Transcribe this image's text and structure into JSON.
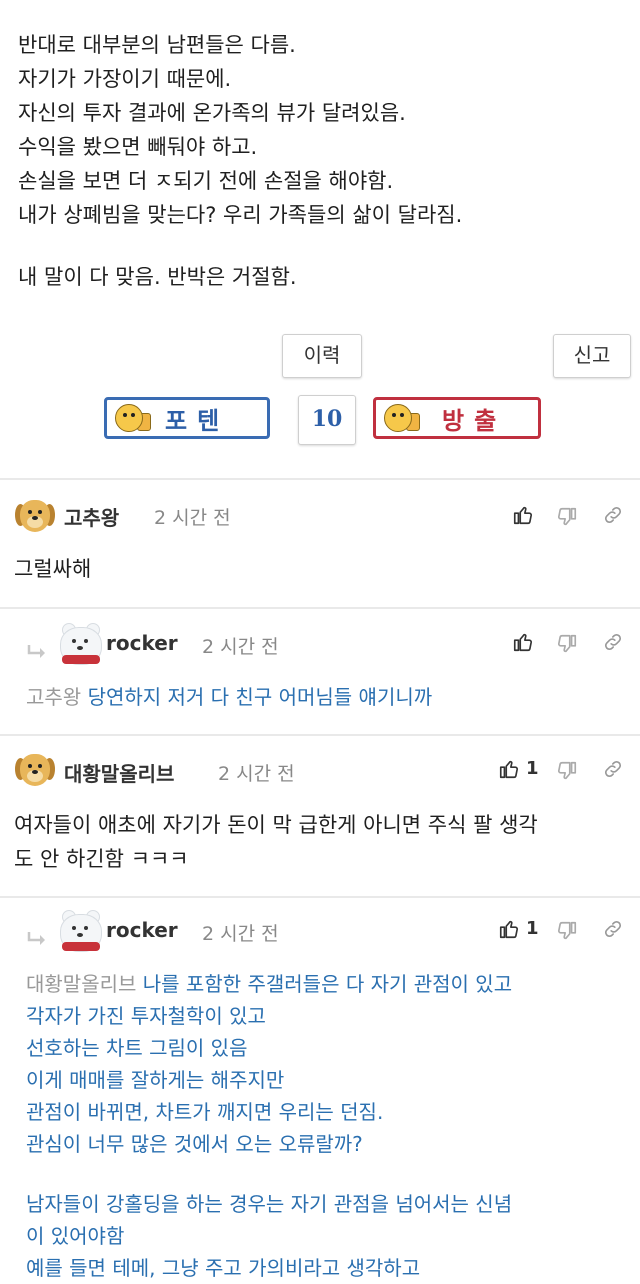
{
  "post": {
    "lines": [
      "반대로 대부분의 남편들은 다름.",
      "자기가 가장이기 때문에.",
      "자신의 투자 결과에 온가족의 뷰가 달려있음.",
      "수익을 봤으면 빼둬야 하고.",
      "손실을 보면 더 ㅈ되기 전에 손절을 해야함.",
      "내가 상폐빔을 맞는다? 우리 가족들의 삶이 달라짐.",
      "",
      "내 말이 다 맞음. 반박은 거절함."
    ]
  },
  "actions": {
    "history": "이력",
    "report": "신고"
  },
  "votes": {
    "up_label": "포텐",
    "down_label": "방출",
    "count": "10"
  },
  "comments": [
    {
      "author": "고추왕",
      "time": "2 시간 전",
      "text": "그럴싸해",
      "likes": ""
    },
    {
      "author": "rocker",
      "time": "2 시간 전",
      "mention": "고추왕",
      "lines": [
        "당연하지 저거 다 친구 어머님들 얘기니까"
      ],
      "likes": ""
    },
    {
      "author": "대황말올리브",
      "time": "2 시간 전",
      "lines": [
        "여자들이 애초에 자기가 돈이 막 급한게 아니면 주식 팔 생각",
        "도 안 하긴함 ㅋㅋㅋ"
      ],
      "likes": "1"
    },
    {
      "author": "rocker",
      "time": "2 시간 전",
      "mention": "대황말올리브",
      "lines": [
        "나를 포함한 주갤러들은 다 자기 관점이 있고",
        "각자가 가진 투자철학이 있고",
        "선호하는 차트 그림이 있음",
        "이게 매매를 잘하게는 해주지만",
        "관점이 바뀌면, 차트가 깨지면 우리는 던짐.",
        "관심이 너무 많은 것에서 오는 오류랄까?",
        "",
        "남자들이 강홀딩을 하는 경우는 자기 관점을 넘어서는 신념",
        "이 있어야함",
        "예를 들면 테메, 그냥 주고 가의비라고 생각하고"
      ],
      "likes": "1"
    }
  ]
}
